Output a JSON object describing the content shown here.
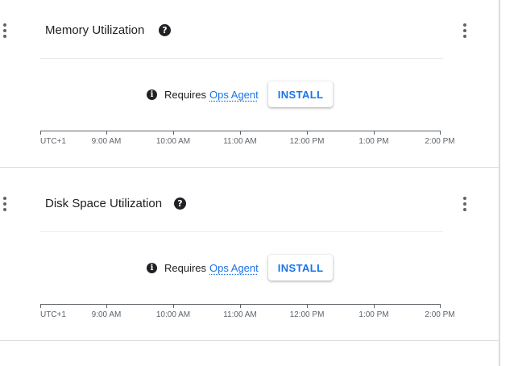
{
  "cards": [
    {
      "title": "Memory Utilization",
      "requires_text": "Requires",
      "link_text": "Ops Agent",
      "button_label": "INSTALL",
      "axis": {
        "timezone": "UTC+1",
        "ticks": [
          "9:00 AM",
          "10:00 AM",
          "11:00 AM",
          "12:00 PM",
          "1:00 PM",
          "2:00 PM"
        ]
      }
    },
    {
      "title": "Disk Space Utilization",
      "requires_text": "Requires",
      "link_text": "Ops Agent",
      "button_label": "INSTALL",
      "axis": {
        "timezone": "UTC+1",
        "ticks": [
          "9:00 AM",
          "10:00 AM",
          "11:00 AM",
          "12:00 PM",
          "1:00 PM",
          "2:00 PM"
        ]
      }
    }
  ],
  "icons": {
    "help": "question-circle",
    "info": "info-circle",
    "drag": "drag-handle",
    "more": "more-vert"
  },
  "colors": {
    "link": "#1a73e8",
    "divider": "#dadce0",
    "text": "#202124",
    "muted": "#5f6368"
  }
}
